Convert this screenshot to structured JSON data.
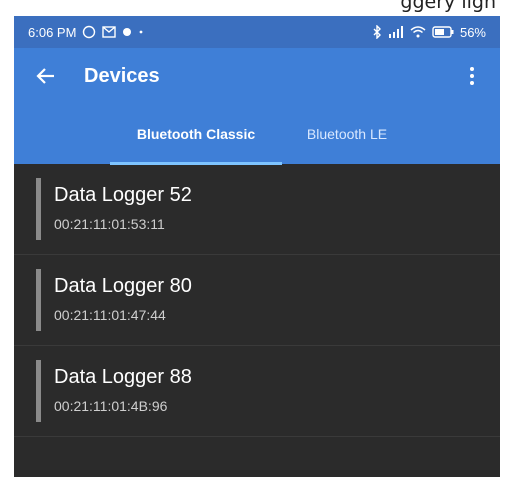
{
  "top_cut_text": "ggery ligh",
  "status": {
    "time": "6:06 PM",
    "battery": "56%"
  },
  "appbar": {
    "title": "Devices"
  },
  "tabs": [
    {
      "label": "Bluetooth Classic",
      "active": true
    },
    {
      "label": "Bluetooth LE",
      "active": false
    }
  ],
  "devices": [
    {
      "name": "Data Logger 52",
      "address": "00:21:11:01:53:11"
    },
    {
      "name": "Data Logger 80",
      "address": "00:21:11:01:47:44"
    },
    {
      "name": "Data Logger 88",
      "address": "00:21:11:01:4B:96"
    }
  ],
  "colors": {
    "status_bar": "#3b6fbf",
    "app_bar": "#3f7fd7",
    "tab_indicator": "#7ec4ff",
    "list_bg": "#2b2b2b"
  }
}
